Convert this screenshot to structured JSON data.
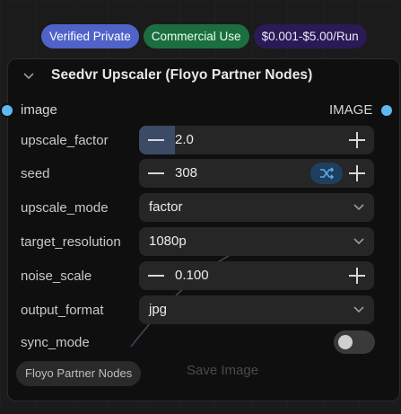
{
  "badges": {
    "verified": "Verified Private",
    "commercial": "Commercial Use",
    "price": "$0.001-$5.00/Run"
  },
  "node": {
    "title": "Seedvr Upscaler (Floyo Partner Nodes)",
    "input_label": "image",
    "output_label": "IMAGE",
    "widgets": {
      "upscale_factor": {
        "label": "upscale_factor",
        "value": "2.0"
      },
      "seed": {
        "label": "seed",
        "value": "308"
      },
      "upscale_mode": {
        "label": "upscale_mode",
        "value": "factor"
      },
      "target_resolution": {
        "label": "target_resolution",
        "value": "1080p"
      },
      "noise_scale": {
        "label": "noise_scale",
        "value": "0.100"
      },
      "output_format": {
        "label": "output_format",
        "value": "jpg"
      },
      "sync_mode": {
        "label": "sync_mode",
        "value": false
      }
    },
    "footer_tag": "Floyo Partner Nodes",
    "save_label": "Save Image"
  },
  "colors": {
    "port": "#5fb8f0",
    "verified": "#4f63c9",
    "commercial": "#1b6e3f",
    "price": "#2a1a55",
    "widget_bg": "#262626",
    "node_bg": "#0f0f0f"
  },
  "icons": {
    "collapse": "chevron-down-icon",
    "dropdown": "chevron-down-icon",
    "randomize": "shuffle-icon"
  }
}
